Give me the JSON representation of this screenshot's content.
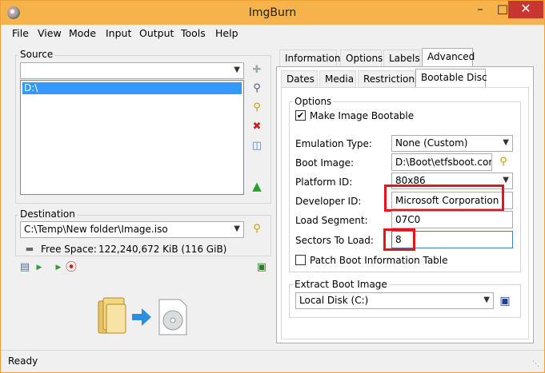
{
  "window": {
    "title": "ImgBurn"
  },
  "menu": [
    "File",
    "View",
    "Mode",
    "Input",
    "Output",
    "Tools",
    "Help"
  ],
  "source": {
    "group_label": "Source",
    "combo_value": "",
    "list_items": [
      "D:\\"
    ]
  },
  "destination": {
    "group_label": "Destination",
    "path": "C:\\Temp\\New folder\\Image.iso",
    "free_space_label": "Free Space:",
    "free_space_value": "122,240,672 KiB  (116 GiB)"
  },
  "tabs_top": [
    "Information",
    "Options",
    "Labels",
    "Advanced"
  ],
  "tabs_sub": [
    "Dates",
    "Media",
    "Restrictions",
    "Bootable Disc"
  ],
  "options": {
    "group_label": "Options",
    "make_bootable_label": "Make Image Bootable",
    "make_bootable_checked": true,
    "emulation_label": "Emulation Type:",
    "emulation_value": "None (Custom)",
    "boot_image_label": "Boot Image:",
    "boot_image_value": "D:\\Boot\\etfsboot.com",
    "platform_label": "Platform ID:",
    "platform_value": "80x86",
    "developer_label": "Developer ID:",
    "developer_value": "Microsoft Corporation",
    "load_segment_label": "Load Segment:",
    "load_segment_value": "07C0",
    "sectors_label": "Sectors To Load:",
    "sectors_value": "8",
    "patch_label": "Patch Boot Information Table",
    "patch_checked": false
  },
  "extract": {
    "group_label": "Extract Boot Image",
    "drive_value": "Local Disk (C:)"
  },
  "status": {
    "text": "Ready"
  },
  "colors": {
    "title_bar": "#f7b34b",
    "close_button": "#c7372f",
    "selection": "#3399ff",
    "highlight_box": "#e8141c"
  }
}
